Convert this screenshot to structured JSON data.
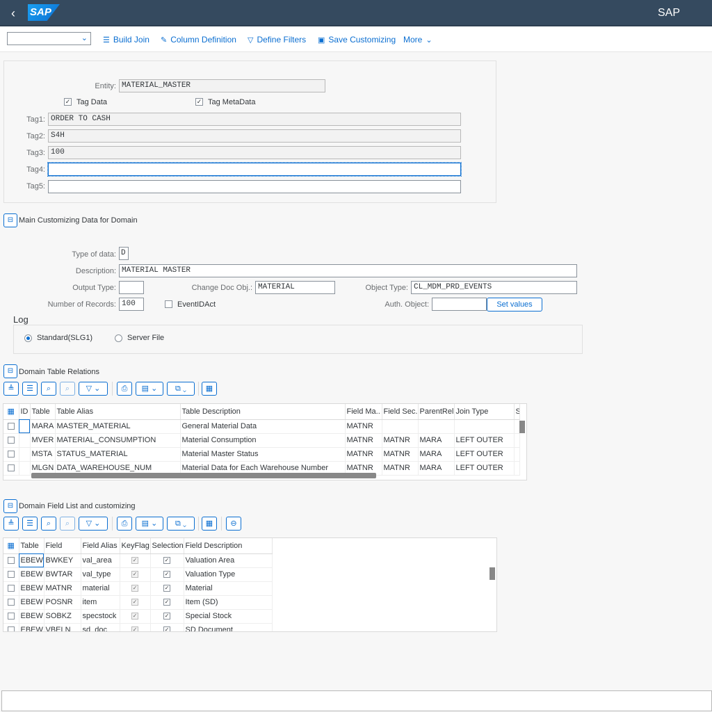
{
  "shell": {
    "logo": "SAP",
    "title": "SAP"
  },
  "toolbar": {
    "select_value": "",
    "build_join": "Build Join",
    "column_definition": "Column Definition",
    "define_filters": "Define Filters",
    "save_customizing": "Save Customizing",
    "more": "More"
  },
  "entity": {
    "entity_label": "Entity:",
    "entity_value": "MATERIAL_MASTER",
    "tag_data_label": "Tag Data",
    "tag_data_checked": true,
    "tag_metadata_label": "Tag MetaData",
    "tag_metadata_checked": true,
    "tags": [
      {
        "label": "Tag1:",
        "value": "ORDER TO CASH"
      },
      {
        "label": "Tag2:",
        "value": "S4H"
      },
      {
        "label": "Tag3:",
        "value": "100"
      },
      {
        "label": "Tag4:",
        "value": ""
      },
      {
        "label": "Tag5:",
        "value": ""
      }
    ]
  },
  "main": {
    "section_title": "Main Customizing Data for Domain",
    "type_label": "Type of data:",
    "type_value": "D",
    "desc_label": "Description:",
    "desc_value": "MATERIAL MASTER",
    "output_label": "Output Type:",
    "output_value": "",
    "changedoc_label": "Change Doc Obj.:",
    "changedoc_value": "MATERIAL",
    "objtype_label": "Object Type:",
    "objtype_value": "CL_MDM_PRD_EVENTS",
    "records_label": "Number of Records:",
    "records_value": "100",
    "eventid_label": "EventIDAct",
    "auth_label": "Auth. Object:",
    "auth_value": "",
    "set_values": "Set values"
  },
  "log": {
    "title": "Log",
    "standard": "Standard(SLG1)",
    "server": "Server File",
    "selected": "standard"
  },
  "relations": {
    "section_title": "Domain Table Relations",
    "columns": [
      "ID",
      "Table",
      "Table Alias",
      "Table Description",
      "Field Ma..",
      "Field Sec.",
      "ParentRel",
      "Join Type",
      "S"
    ],
    "rows": [
      [
        "",
        "MARA",
        "MASTER_MATERIAL",
        "General Material Data",
        "MATNR",
        "",
        "",
        ""
      ],
      [
        "",
        "MVER",
        "MATERIAL_CONSUMPTION",
        "Material Consumption",
        "MATNR",
        "MATNR",
        "MARA",
        "LEFT OUTER"
      ],
      [
        "",
        "MSTA",
        "STATUS_MATERIAL",
        "Material Master Status",
        "MATNR",
        "MATNR",
        "MARA",
        "LEFT OUTER"
      ],
      [
        "",
        "MLGN",
        "DATA_WAREHOUSE_NUM",
        "Material Data for Each Warehouse Number",
        "MATNR",
        "MATNR",
        "MARA",
        "LEFT OUTER"
      ]
    ]
  },
  "fields": {
    "section_title": "Domain Field List and customizing",
    "columns": [
      "Table",
      "Field",
      "Field Alias",
      "KeyFlag",
      "Selection",
      "Field Description"
    ],
    "rows": [
      [
        "EBEW",
        "BWKEY",
        "val_area",
        "Valuation Area"
      ],
      [
        "EBEW",
        "BWTAR",
        "val_type",
        "Valuation Type"
      ],
      [
        "EBEW",
        "MATNR",
        "material",
        "Material"
      ],
      [
        "EBEW",
        "POSNR",
        "item",
        "Item (SD)"
      ],
      [
        "EBEW",
        "SOBKZ",
        "specstock",
        "Special Stock"
      ],
      [
        "EBEW",
        "VBELN",
        "sd_doc",
        "SD Document"
      ]
    ]
  }
}
